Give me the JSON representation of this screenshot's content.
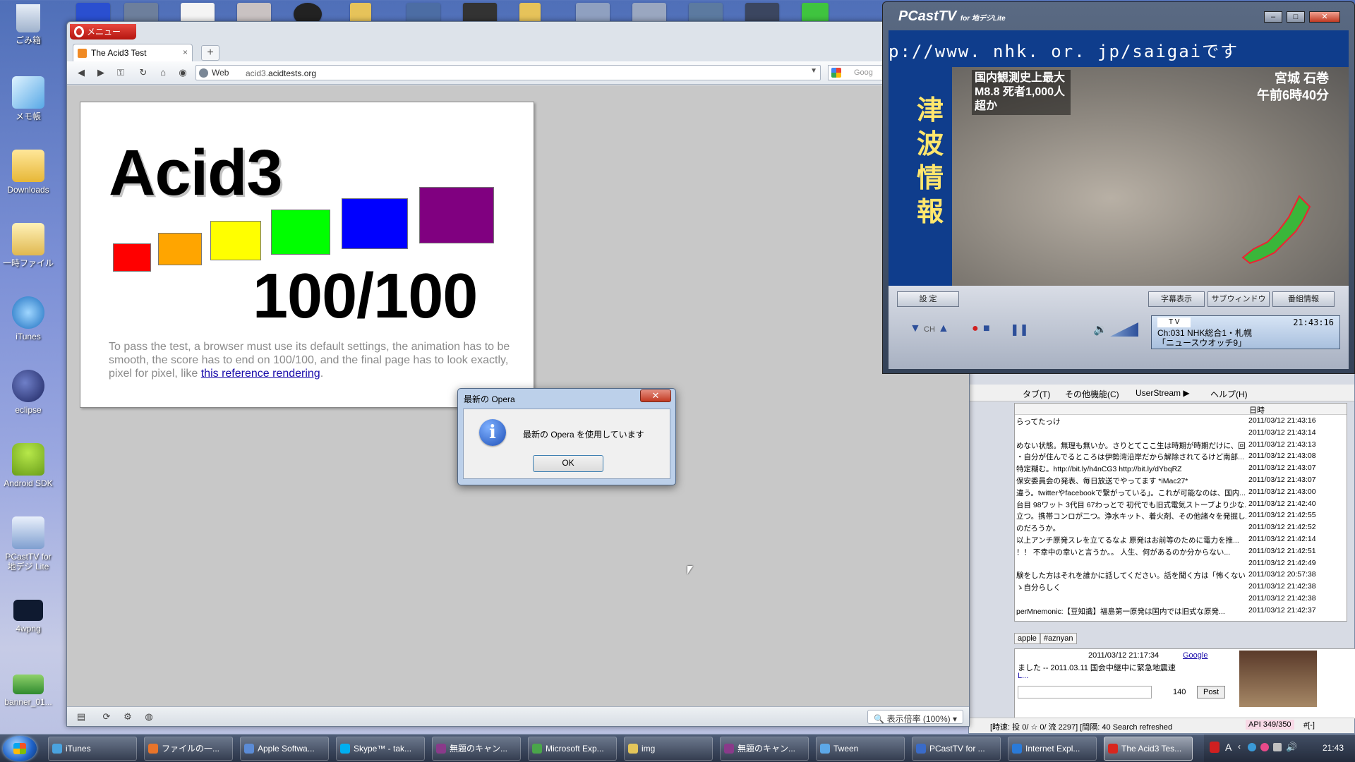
{
  "desktop": {
    "icons": [
      {
        "label": "ごみ箱"
      },
      {
        "label": "メモ帳"
      },
      {
        "label": "Downloads"
      },
      {
        "label": "一時ファイル"
      },
      {
        "label": "iTunes"
      },
      {
        "label": "eclipse"
      },
      {
        "label": "Android SDK"
      },
      {
        "label": "PCastTV for 地デジ Lite"
      },
      {
        "label": "4wpng"
      },
      {
        "label": "banner_01..."
      }
    ]
  },
  "opera": {
    "menu_label": "メニュー",
    "tab_title": "The Acid3 Test",
    "new_tab_label": "+",
    "address_prefix": "Web",
    "url_plain": "acid3.",
    "url_domain": "acidtests.org",
    "search_placeholder": "Goog",
    "zoom_label": "表示倍率 (100%)"
  },
  "acid3": {
    "title": "Acid3",
    "score": "100/100",
    "description": "To pass the test, a browser must use its default settings, the animation has to be smooth, the score has to end on 100/100, and the final page has to look exactly, pixel for pixel, like ",
    "link_text": "this reference rendering",
    "description_end": ".",
    "box_colors": [
      "#ff0000",
      "#ffa500",
      "#ffff00",
      "#00ff00",
      "#0000ff",
      "#800080"
    ]
  },
  "dialog": {
    "title": "最新の Opera",
    "message": "最新の Opera を使用しています",
    "ok_label": "OK",
    "close_label": "✕"
  },
  "pcast": {
    "logo": "PCastTV",
    "logo_sub": "for 地デジLite",
    "ticker": "p://www. nhk. or. jp/saigaiです",
    "vertical_caption": "津波情報",
    "caption_left": "国内観測史上最大 M8.8 死者1,000人超か",
    "caption_right_place": "宮城 石巻",
    "caption_right_time": "午前6時40分",
    "btn_settings": "設 定",
    "btn_subtitles": "字幕表示",
    "btn_subwindow": "サブウィンドウ",
    "btn_program_info": "番組情報",
    "lcd_label": "T V",
    "lcd_time": "21:43:16",
    "lcd_channel": "Ch:031 NHK総合1・札幌",
    "lcd_program": "「ニュースウオッチ9」",
    "ch_label": "CH"
  },
  "tween": {
    "menu": [
      "タブ(T)",
      "その他機能(C)",
      "UserStream ▶",
      "ヘルプ(H)"
    ],
    "date_header": "日時",
    "rows": [
      {
        "text": "らってたっけ",
        "date": "2011/03/12 21:43:16"
      },
      {
        "text": "",
        "date": "2011/03/12 21:43:14"
      },
      {
        "text": "めない状態。無理も無いか。さりとてここ生は時期が時期だけに、回...",
        "date": "2011/03/12 21:43:13"
      },
      {
        "text": "・自分が住んでるところは伊勢湾沿岸だから解除されてるけど南部...",
        "date": "2011/03/12 21:43:08"
      },
      {
        "text": "特定糊む。http://bit.ly/h4nCG3 http://bit.ly/dYbqRZ",
        "date": "2011/03/12 21:43:07"
      },
      {
        "text": "保安委員会の発表、毎日放送でやってます *iMac27*",
        "date": "2011/03/12 21:43:07"
      },
      {
        "text": "違う。twitterやfacebookで繋がっている」。これが可能なのは、国内...",
        "date": "2011/03/12 21:43:00"
      },
      {
        "text": "台目 98ワット 3代目 67わっとで 初代でも旧式電気ストーブより少な...",
        "date": "2011/03/12 21:42:40"
      },
      {
        "text": "立つ。携帯コンロが二つ。浄水キット、着火剤、その他諸々を発掘し...",
        "date": "2011/03/12 21:42:55"
      },
      {
        "text": "のだろうか。",
        "date": "2011/03/12 21:42:52"
      },
      {
        "text": "以上アンチ原発スレを立てるなよ 原発はお前等のために電力を推...",
        "date": "2011/03/12 21:42:14"
      },
      {
        "text": "！！ 不幸中の幸いと言うか。。 人生、何があるのか分からない...",
        "date": "2011/03/12 21:42:51"
      },
      {
        "text": "",
        "date": "2011/03/12 21:42:49"
      },
      {
        "text": "験をした方はそれを誰かに話してください。話を聞く方は「怖くないよ」...",
        "date": "2011/03/12 20:57:38"
      },
      {
        "text": "ゝ自分らしく",
        "date": "2011/03/12 21:42:38"
      },
      {
        "text": "",
        "date": "2011/03/12 21:42:38"
      },
      {
        "text": "perMnemonic:【豆知識】福島第一原発は国内では旧式な原発...",
        "date": "2011/03/12 21:42:37"
      }
    ],
    "tabs": [
      "apple",
      "#aznyan"
    ],
    "detail_time": "2011/03/12 21:17:34",
    "detail_link": "Google",
    "detail_text": "ました -- 2011.03.11 国会中継中に緊急地震速",
    "detail_text2": "L...",
    "char_count": "140",
    "post_label": "Post",
    "status": "[時速: 投 0/ ☆ 0/ 流 2297] [間隔: 40 Search refreshed",
    "api": "API 349/350",
    "hash": "#[-]"
  },
  "taskbar": {
    "tasks": [
      {
        "label": "iTunes",
        "color": "#4aa3df"
      },
      {
        "label": "ファイルの一...",
        "color": "#e8742a"
      },
      {
        "label": "Apple Softwa...",
        "color": "#5b8bd6"
      },
      {
        "label": "Skype™ - tak...",
        "color": "#00aff0"
      },
      {
        "label": "無題のキャン...",
        "color": "#8a3a8a"
      },
      {
        "label": "Microsoft Exp...",
        "color": "#4aa64a"
      },
      {
        "label": "img",
        "color": "#e3c55a"
      },
      {
        "label": "無題のキャン...",
        "color": "#8a3a8a"
      },
      {
        "label": "Tween",
        "color": "#5da8e8"
      },
      {
        "label": "PCastTV for ...",
        "color": "#3a6bc8"
      },
      {
        "label": "Internet Expl...",
        "color": "#2a7ad8"
      },
      {
        "label": "The Acid3 Tes...",
        "color": "#d8261e"
      }
    ],
    "clock": "21:43"
  }
}
